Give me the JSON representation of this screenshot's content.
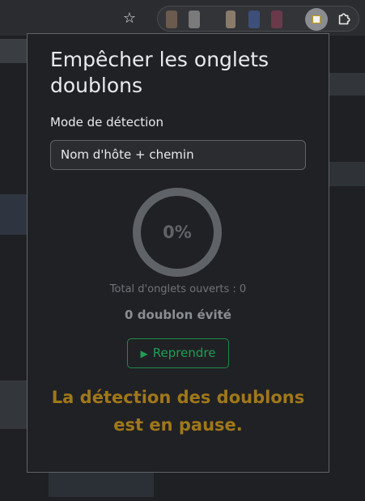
{
  "browser": {
    "bookmark_icon": "star-icon",
    "extensions_icon": "puzzle-icon"
  },
  "popup": {
    "title": "Empêcher les onglets doublons",
    "mode_label": "Mode de détection",
    "mode_value": "Nom d'hôte + chemin",
    "gauge_value": "0%",
    "gauge_fraction": 0,
    "total_tabs": "Total d'onglets ouverts : 0",
    "avoided": "0 doublon évité",
    "resume_label": "Reprendre",
    "paused_message": "La détection des doublons est en pause."
  },
  "colors": {
    "accent_green": "#1f9d55",
    "paused_text": "#a0781a",
    "background": "#202124"
  }
}
